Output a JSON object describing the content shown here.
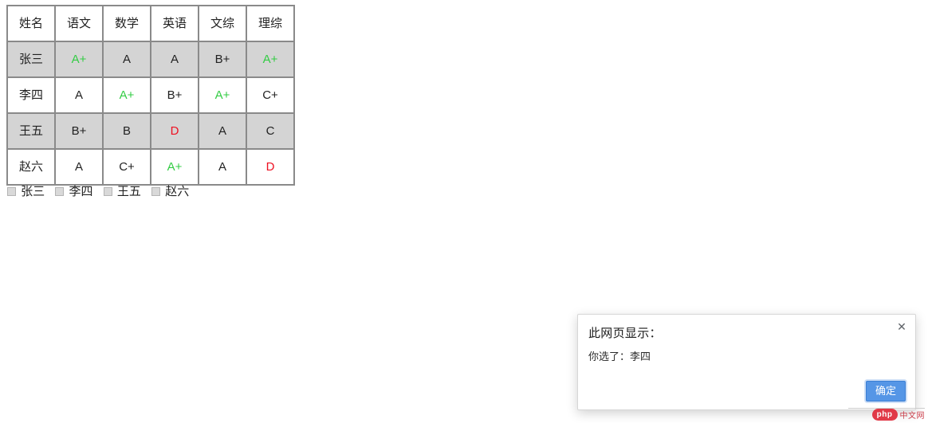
{
  "page": {
    "background_color": "#ffffff"
  },
  "table": {
    "name": "grade-table",
    "border_color": "#8a8a8a",
    "odd_row_color": "#d4d4d4",
    "even_row_color": "#ffffff",
    "grade_colors": {
      "green": "#33cc44",
      "red": "#ee1122",
      "plain": "#222222"
    },
    "headers": [
      "姓名",
      "语文",
      "数学",
      "英语",
      "文综",
      "理综"
    ],
    "rows": [
      {
        "name": "张三",
        "highlighted": true,
        "cells": [
          {
            "text": "张三",
            "color": "plain"
          },
          {
            "text": "A+",
            "color": "green"
          },
          {
            "text": "A",
            "color": "plain"
          },
          {
            "text": "A",
            "color": "plain"
          },
          {
            "text": "B+",
            "color": "plain"
          },
          {
            "text": "A+",
            "color": "green"
          }
        ]
      },
      {
        "name": "李四",
        "highlighted": false,
        "cells": [
          {
            "text": "李四",
            "color": "plain"
          },
          {
            "text": "A",
            "color": "plain"
          },
          {
            "text": "A+",
            "color": "green"
          },
          {
            "text": "B+",
            "color": "plain"
          },
          {
            "text": "A+",
            "color": "green"
          },
          {
            "text": "C+",
            "color": "plain"
          }
        ]
      },
      {
        "name": "王五",
        "highlighted": true,
        "cells": [
          {
            "text": "王五",
            "color": "plain"
          },
          {
            "text": "B+",
            "color": "plain"
          },
          {
            "text": "B",
            "color": "plain"
          },
          {
            "text": "D",
            "color": "red"
          },
          {
            "text": "A",
            "color": "plain"
          },
          {
            "text": "C",
            "color": "plain"
          }
        ]
      },
      {
        "name": "赵六",
        "highlighted": false,
        "cells": [
          {
            "text": "赵六",
            "color": "plain"
          },
          {
            "text": "A",
            "color": "plain"
          },
          {
            "text": "C+",
            "color": "plain"
          },
          {
            "text": "A+",
            "color": "green"
          },
          {
            "text": "A",
            "color": "plain"
          },
          {
            "text": "D",
            "color": "red"
          }
        ]
      }
    ]
  },
  "checkboxes": {
    "items": [
      {
        "label": "张三",
        "checked": false
      },
      {
        "label": "李四",
        "checked": false
      },
      {
        "label": "王五",
        "checked": false
      },
      {
        "label": "赵六",
        "checked": false
      }
    ]
  },
  "dialog": {
    "title": "此网页显示：",
    "message": "你选了：李四",
    "close_icon": "✕",
    "ok_label": "确定",
    "accent_color": "#5596e6"
  },
  "watermark": {
    "badge": "php",
    "text": "中文网",
    "color": "#e02b3a"
  }
}
